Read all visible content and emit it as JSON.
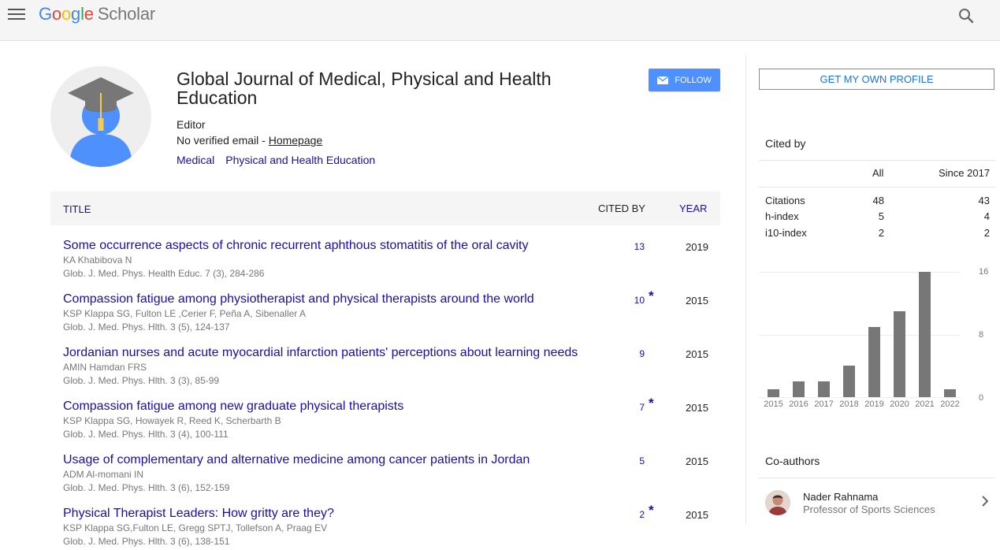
{
  "header": {
    "logo_google": "Google",
    "logo_scholar": "Scholar",
    "menu_icon": "hamburger-menu-icon",
    "search_icon": "search-icon"
  },
  "profile": {
    "name": "Global Journal of Medical, Physical and Health Education",
    "affiliation": "Editor",
    "email_text": "No verified email - ",
    "homepage_label": "Homepage",
    "interests": [
      "Medical",
      "Physical and Health Education"
    ],
    "follow_label": "FOLLOW"
  },
  "table": {
    "headers": {
      "title": "TITLE",
      "cited_by": "CITED BY",
      "year": "YEAR"
    },
    "rows": [
      {
        "title": "Some occurrence aspects of chronic recurrent aphthous stomatitis of the oral cavity",
        "authors": "KA Khabibova N",
        "venue": "Glob. J. Med. Phys. Health Educ. 7 (3), 284-286",
        "cited": "13",
        "star": "",
        "year": "2019"
      },
      {
        "title": "Compassion fatigue among physiotherapist and physical therapists around the world",
        "authors": "KSP Klappa SG, Fulton LE ,Cerier F, Peña A, Sibenaller A",
        "venue": "Glob. J. Med. Phys. Hlth. 3 (5), 124-137",
        "cited": "10",
        "star": "*",
        "year": "2015"
      },
      {
        "title": "Jordanian nurses and acute myocardial infarction patients' perceptions about learning needs",
        "authors": "AMIN Hamdan FRS",
        "venue": "Glob. J. Med. Phys. Hlth. 3 (3), 85-99",
        "cited": "9",
        "star": "",
        "year": "2015"
      },
      {
        "title": "Compassion fatigue among new graduate physical therapists",
        "authors": "KSP Klappa SG, Howayek R, Reed K, Scherbarth B",
        "venue": "Glob. J. Med. Phys. Hlth. 3 (4), 100-111",
        "cited": "7",
        "star": "*",
        "year": "2015"
      },
      {
        "title": "Usage of complementary and alternative medicine among cancer patients in Jordan",
        "authors": "ADM Al-momani IN",
        "venue": "Glob. J. Med. Phys. Hlth. 3 (6), 152-159",
        "cited": "5",
        "star": "",
        "year": "2015"
      },
      {
        "title": "Physical Therapist Leaders: How gritty are they?",
        "authors": "KSP Klappa SG,Fulton LE, Gregg SPTJ, Tollefson A, Praag EV",
        "venue": "Glob. J. Med. Phys. Hlth. 3 (6), 138-151",
        "cited": "2",
        "star": "*",
        "year": "2015"
      }
    ]
  },
  "sidebar": {
    "get_profile_label": "GET MY OWN PROFILE",
    "cited_by_title": "Cited by",
    "col_all": "All",
    "col_since": "Since 2017",
    "stats": [
      {
        "label": "Citations",
        "all": "48",
        "since": "43"
      },
      {
        "label": "h-index",
        "all": "5",
        "since": "4"
      },
      {
        "label": "i10-index",
        "all": "2",
        "since": "2"
      }
    ],
    "coauthors_title": "Co-authors",
    "coauthor": {
      "name": "Nader Rahnama",
      "affiliation": "Professor of Sports Sciences"
    }
  },
  "chart_data": {
    "type": "bar",
    "categories": [
      "2015",
      "2016",
      "2017",
      "2018",
      "2019",
      "2020",
      "2021",
      "2022"
    ],
    "values": [
      1,
      2,
      2,
      4,
      9,
      11,
      16,
      1
    ],
    "y_ticks": [
      "16",
      "8",
      "0"
    ],
    "ylim": [
      0,
      16
    ],
    "bar_color": "#777777"
  }
}
